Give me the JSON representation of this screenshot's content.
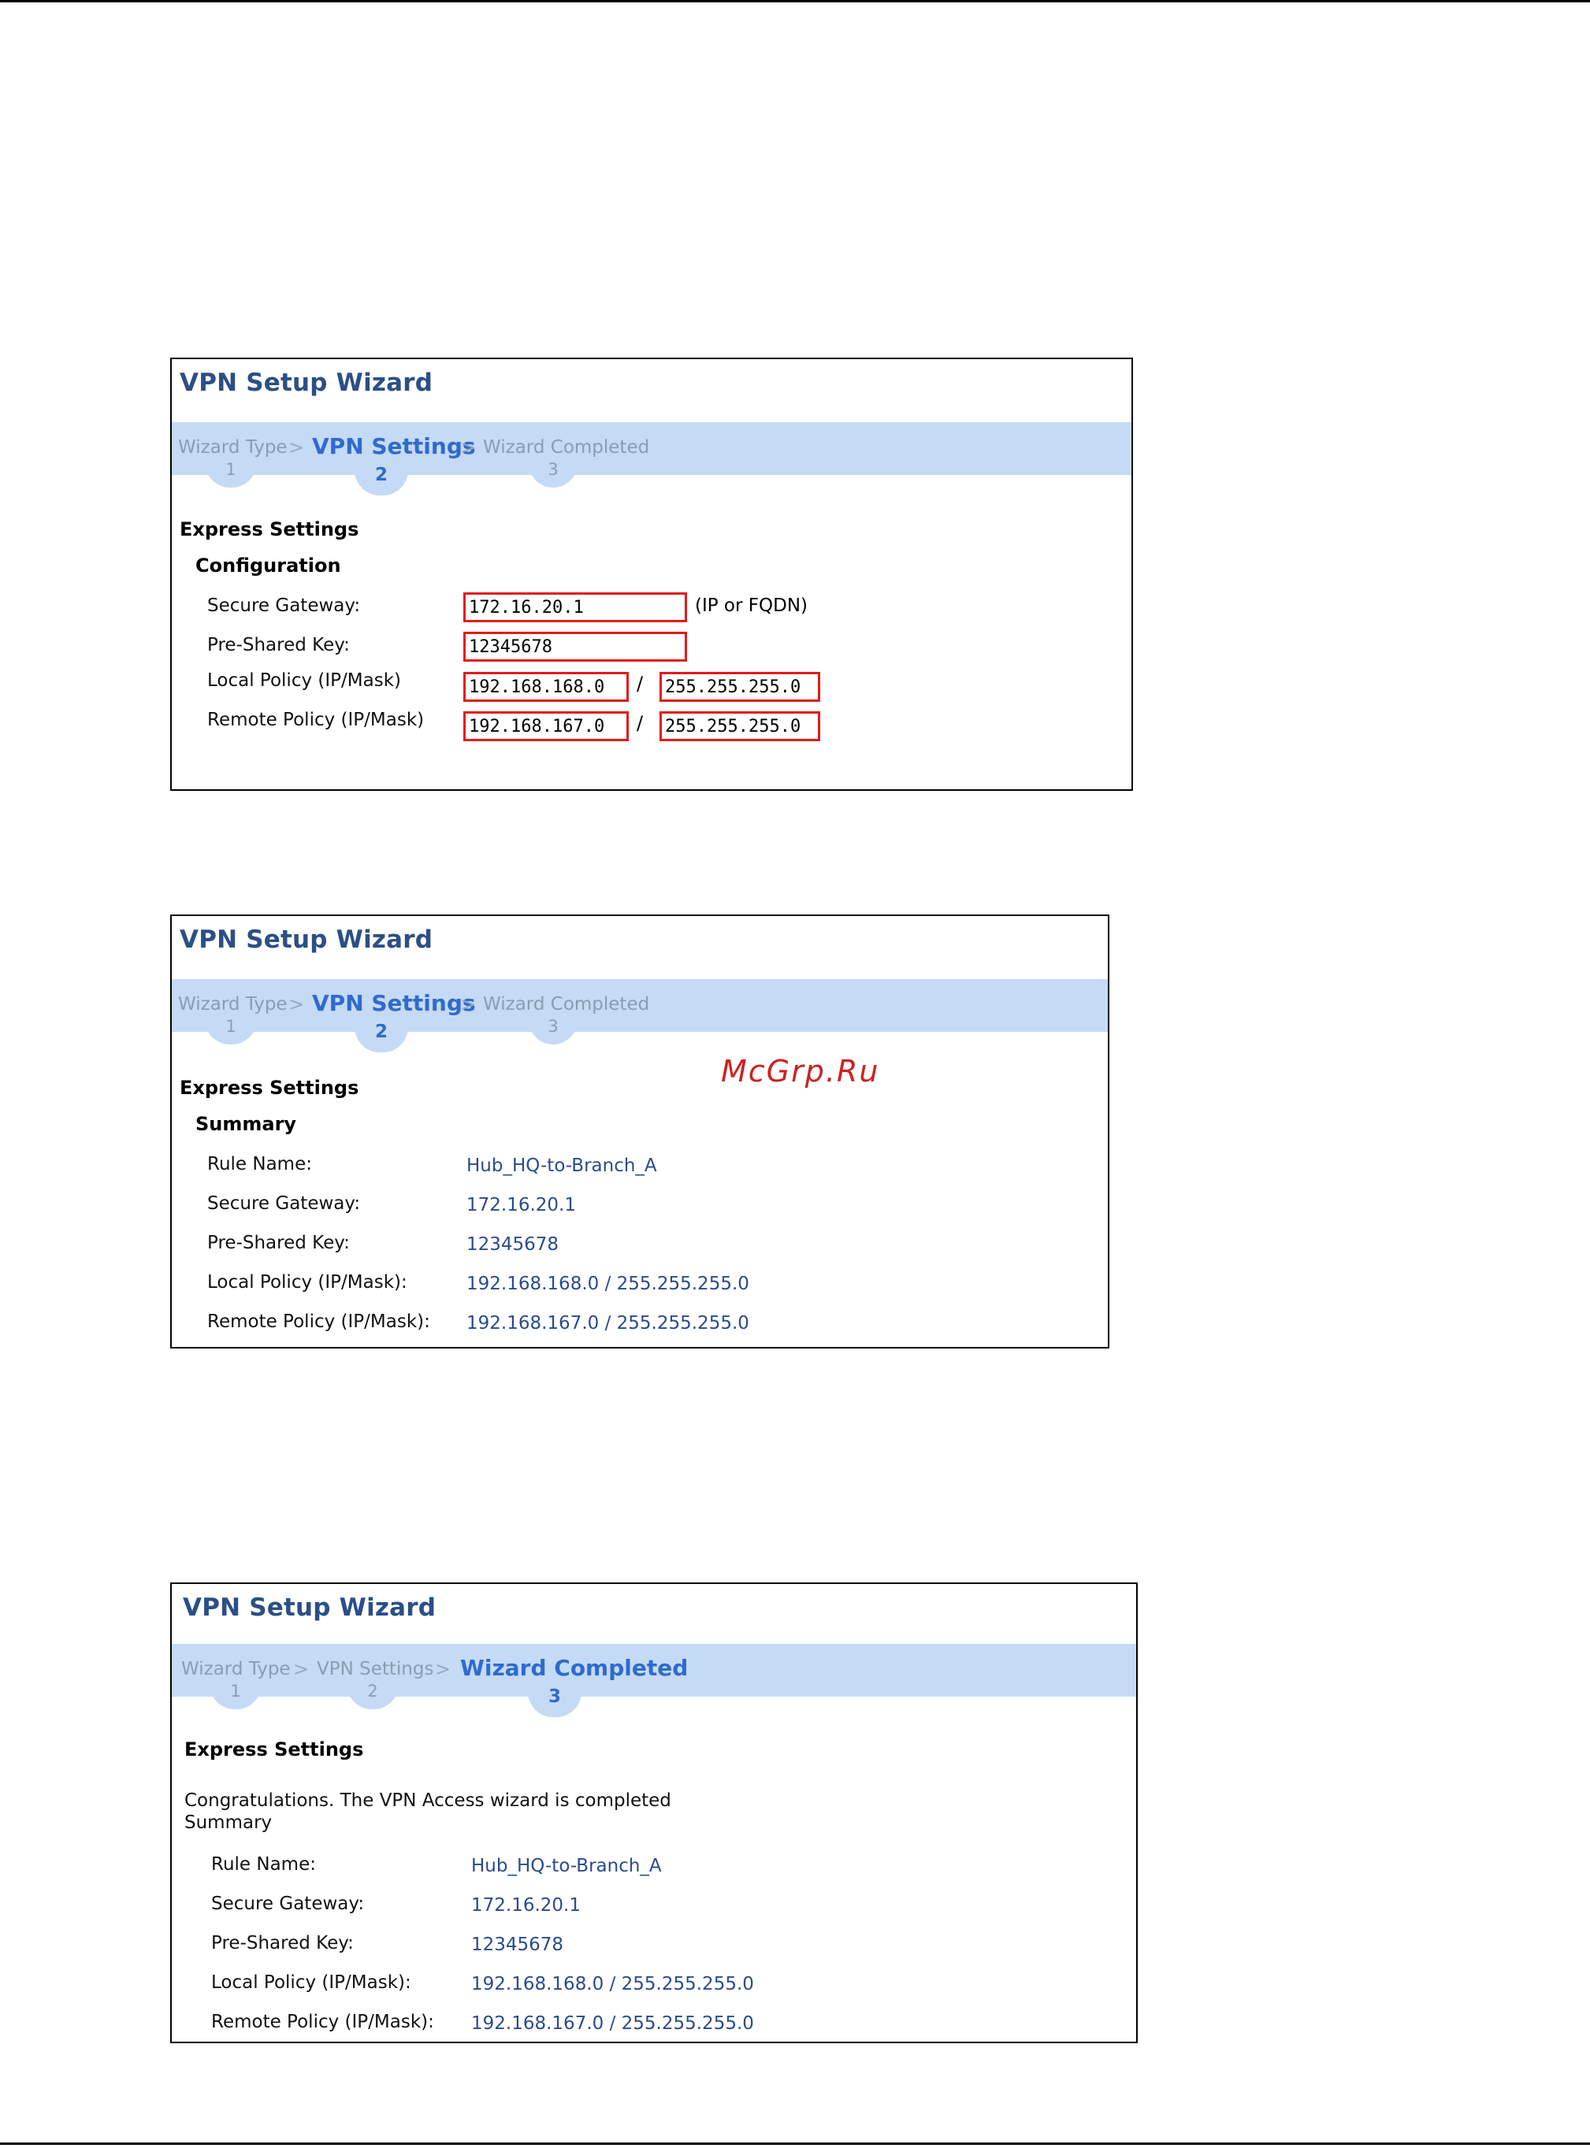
{
  "watermark": "McGrp.Ru",
  "panel1": {
    "title": "VPN Setup Wizard",
    "steps": [
      {
        "label": "Wizard Type",
        "num": "1"
      },
      {
        "label": "VPN Settings",
        "num": "2"
      },
      {
        "label": "Wizard Completed",
        "num": "3"
      }
    ],
    "section": "Express Settings",
    "subsection": "Configuration",
    "labels": {
      "secure_gateway": "Secure Gateway:",
      "pre_shared_key": "Pre-Shared Key:",
      "local_policy": "Local Policy (IP/Mask)",
      "remote_policy": "Remote Policy (IP/Mask)"
    },
    "fields": {
      "secure_gateway": "172.16.20.1",
      "pre_shared_key": "12345678",
      "local_ip": "192.168.168.0",
      "local_mask": "255.255.255.0",
      "remote_ip": "192.168.167.0",
      "remote_mask": "255.255.255.0"
    },
    "slash": "/",
    "gateway_hint": "(IP or FQDN)"
  },
  "panel2": {
    "title": "VPN Setup Wizard",
    "steps": [
      {
        "label": "Wizard Type",
        "num": "1"
      },
      {
        "label": "VPN Settings",
        "num": "2"
      },
      {
        "label": "Wizard Completed",
        "num": "3"
      }
    ],
    "section": "Express Settings",
    "subsection": "Summary",
    "rows": [
      {
        "label": "Rule Name:",
        "value": "Hub_HQ-to-Branch_A"
      },
      {
        "label": "Secure Gateway:",
        "value": "172.16.20.1"
      },
      {
        "label": "Pre-Shared Key:",
        "value": "12345678"
      },
      {
        "label": "Local Policy (IP/Mask):",
        "value": "192.168.168.0 / 255.255.255.0"
      },
      {
        "label": "Remote Policy (IP/Mask):",
        "value": "192.168.167.0 / 255.255.255.0"
      }
    ]
  },
  "panel3": {
    "title": "VPN Setup Wizard",
    "steps": [
      {
        "label": "Wizard Type",
        "num": "1"
      },
      {
        "label": "VPN Settings",
        "num": "2"
      },
      {
        "label": "Wizard Completed",
        "num": "3"
      }
    ],
    "section": "Express Settings",
    "message": "Congratulations. The VPN Access wizard is completed",
    "summary_label": "Summary",
    "rows": [
      {
        "label": "Rule Name:",
        "value": "Hub_HQ-to-Branch_A"
      },
      {
        "label": "Secure Gateway:",
        "value": "172.16.20.1"
      },
      {
        "label": "Pre-Shared Key:",
        "value": "12345678"
      },
      {
        "label": "Local Policy (IP/Mask):",
        "value": "192.168.168.0 / 255.255.255.0"
      },
      {
        "label": "Remote Policy (IP/Mask):",
        "value": "192.168.167.0 / 255.255.255.0"
      }
    ]
  }
}
